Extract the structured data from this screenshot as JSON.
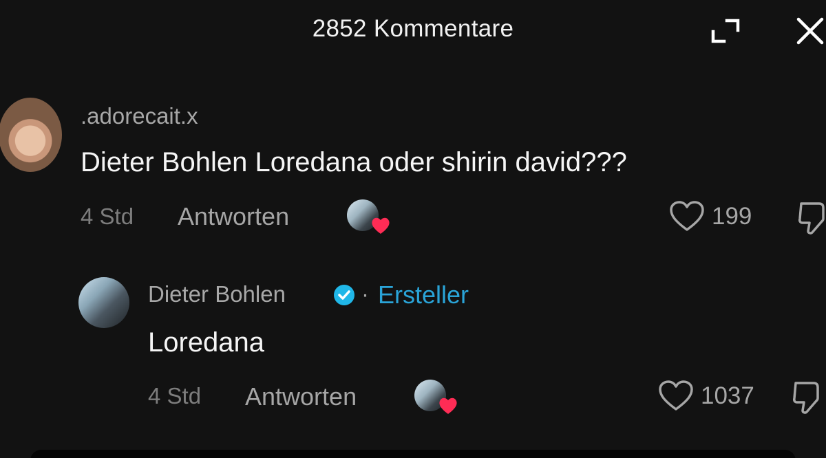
{
  "header": {
    "title": "2852 Kommentare"
  },
  "comments": [
    {
      "username": ".adorecait.x",
      "text": "Dieter Bohlen Loredana oder shirin david???",
      "time": "4 Std",
      "reply_label": "Antworten",
      "likes": "199"
    }
  ],
  "reply": {
    "username": "Dieter Bohlen",
    "separator": "·",
    "creator_label": "Ersteller",
    "text": "Loredana",
    "time": "4 Std",
    "reply_label": "Antworten",
    "likes": "1037"
  },
  "colors": {
    "background": "#121212",
    "accent_verified": "#20b7e8",
    "creator_label": "#2aa4d8",
    "heart_badge": "#fe2c55"
  },
  "icons": [
    "expand-icon",
    "close-icon",
    "heart-icon",
    "dislike-icon",
    "verified-icon",
    "heart-badge-icon"
  ]
}
